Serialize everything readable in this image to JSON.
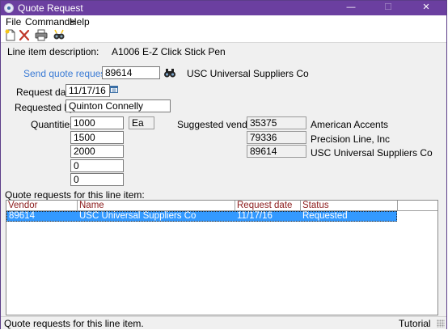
{
  "window": {
    "title": "Quote Request",
    "minimize": "—",
    "maximize": "☐",
    "close": "✕"
  },
  "menu": [
    "File",
    "Commands",
    "Help"
  ],
  "toolbar": {
    "icons": [
      "new-document-icon",
      "delete-icon",
      "print-icon",
      "find-icon"
    ]
  },
  "form": {
    "line_item_label": "Line item description:",
    "line_item_value": "A1006 E-Z Click Stick Pen",
    "send_to_label": "Send quote request to:",
    "send_to_value": "89614",
    "send_to_vendor_name": "USC Universal Suppliers Co",
    "request_date_label": "Request date:",
    "request_date_value": "11/17/16",
    "requested_by_label": "Requested by:",
    "requested_by_value": "Quinton Connelly",
    "quantities_label": "Quantities:",
    "quantities": [
      "1000",
      "1500",
      "2000",
      "0",
      "0"
    ],
    "unit": "Ea",
    "suggested_vendors_label": "Suggested vendors:",
    "suggested_vendors": [
      {
        "code": "35375",
        "name": "American Accents"
      },
      {
        "code": "79336",
        "name": "Precision Line, Inc"
      },
      {
        "code": "89614",
        "name": "USC Universal Suppliers Co"
      }
    ]
  },
  "grid": {
    "caption": "Quote requests for this line item:",
    "columns": [
      "Vendor",
      "Name",
      "Request date",
      "Status"
    ],
    "rows": [
      {
        "vendor": "89614",
        "name": "USC Universal Suppliers Co",
        "date": "11/17/16",
        "status": "Requested"
      }
    ]
  },
  "status": {
    "left": "Quote requests for this line item.",
    "right": "Tutorial"
  }
}
